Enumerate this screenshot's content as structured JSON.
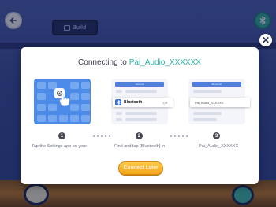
{
  "header": {
    "build_label": "Build",
    "back_icon": "back-arrow-icon",
    "bluetooth_icon": "bluetooth-icon"
  },
  "dialog": {
    "title_prefix": "Connecting to",
    "device_name": "Pai_Audio_XXXXXX",
    "close_icon": "close-icon",
    "cards": {
      "card2_header": "General",
      "card2_row_label": "Bluetooth",
      "card2_row_state": "On",
      "card3_header": "Bluetooth",
      "card3_row_label": "Pai_Audio_XXXXXX"
    },
    "steps": [
      {
        "number": "1",
        "text": "Tap the Settings app on your"
      },
      {
        "number": "2",
        "text": "Find and tap [Bluetooth] in"
      },
      {
        "number": "3",
        "text": "Pai_Audio_XXXXXX"
      }
    ],
    "connect_later_label": "Connect Later"
  },
  "colors": {
    "accent_teal": "#2bb0a4",
    "button_orange": "#f3a61b",
    "background_blue": "#3a4ea0"
  }
}
